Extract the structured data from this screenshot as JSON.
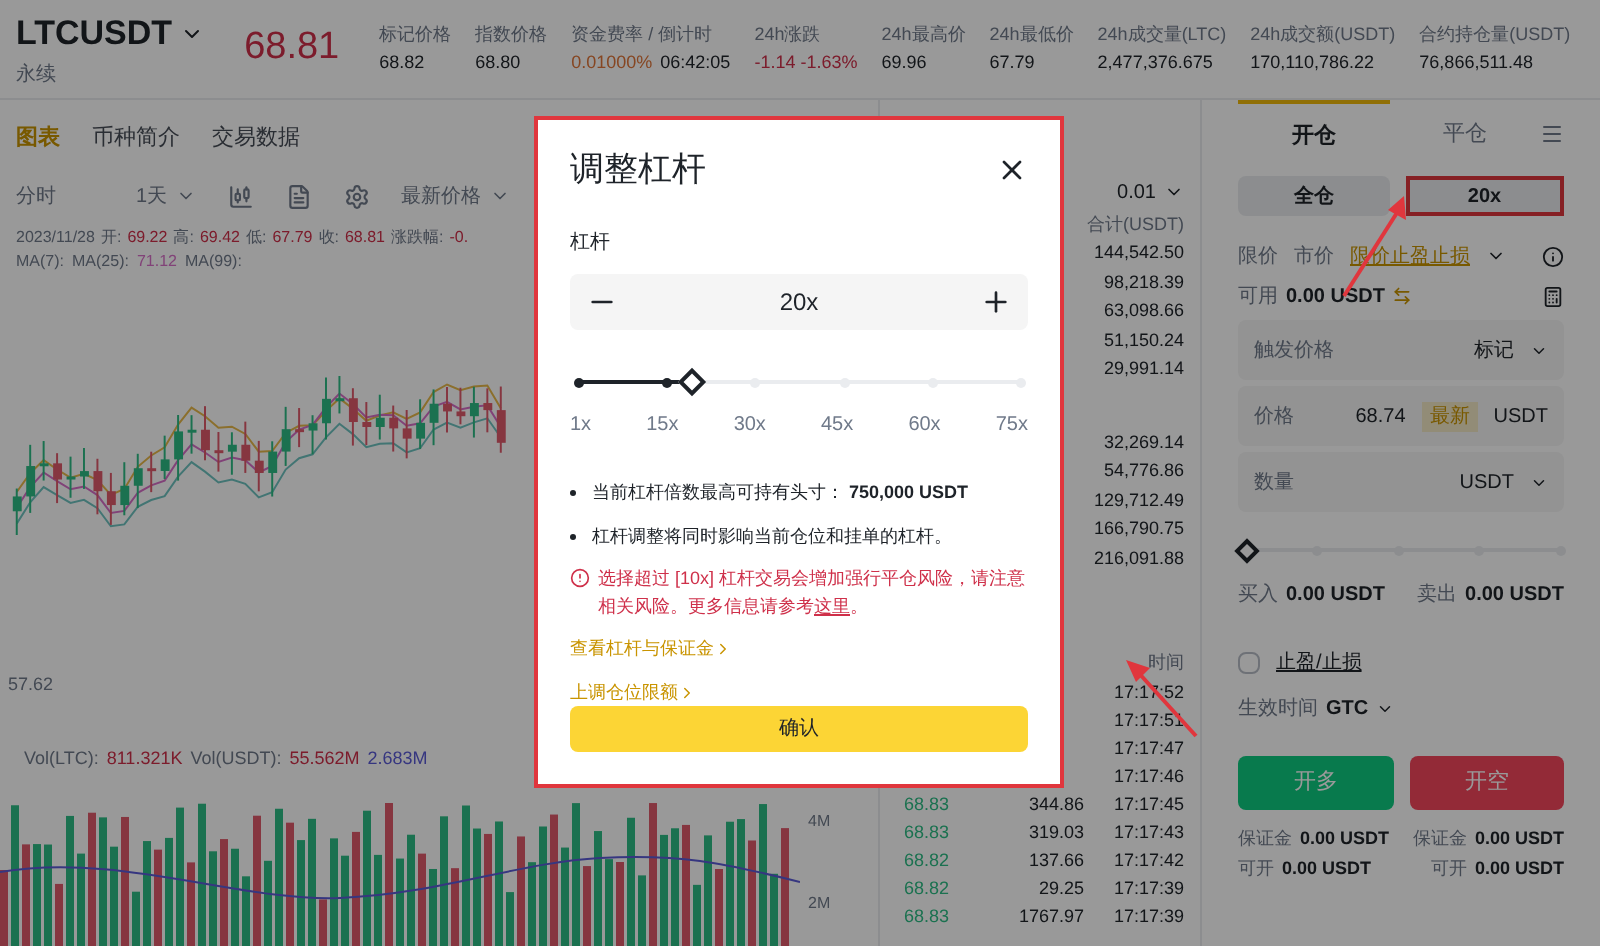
{
  "header": {
    "symbol": "LTCUSDT",
    "subtitle": "永续",
    "price": "68.81",
    "stats": [
      {
        "label": "标记价格",
        "values": [
          {
            "text": "68.82",
            "kind": "plain"
          }
        ]
      },
      {
        "label": "指数价格",
        "values": [
          {
            "text": "68.80",
            "kind": "plain"
          }
        ]
      },
      {
        "label": "资金费率 / 倒计时",
        "values": [
          {
            "text": "0.01000%",
            "kind": "accent"
          },
          {
            "text": "06:42:05",
            "kind": "plain"
          }
        ]
      },
      {
        "label": "24h涨跌",
        "values": [
          {
            "text": "-1.14 -1.63%",
            "kind": "down"
          }
        ]
      },
      {
        "label": "24h最高价",
        "values": [
          {
            "text": "69.96",
            "kind": "plain"
          }
        ]
      },
      {
        "label": "24h最低价",
        "values": [
          {
            "text": "67.79",
            "kind": "plain"
          }
        ]
      },
      {
        "label": "24h成交量(LTC)",
        "values": [
          {
            "text": "2,477,376.675",
            "kind": "plain"
          }
        ]
      },
      {
        "label": "24h成交额(USDT)",
        "values": [
          {
            "text": "170,110,786.22",
            "kind": "plain"
          }
        ]
      },
      {
        "label": "合约持仓量(USDT)",
        "values": [
          {
            "text": "76,866,511.48",
            "kind": "plain"
          }
        ]
      }
    ]
  },
  "chart": {
    "tabs": [
      {
        "label": "图表",
        "selected": true
      },
      {
        "label": "币种简介",
        "selected": false
      },
      {
        "label": "交易数据",
        "selected": false
      }
    ],
    "interval": "分时",
    "period": "1天",
    "price_type": "最新价格",
    "ohlc": {
      "date": "2023/11/28",
      "items": [
        {
          "label": "开:",
          "value": "69.22"
        },
        {
          "label": "高:",
          "value": "69.42"
        },
        {
          "label": "低:",
          "value": "67.79"
        },
        {
          "label": "收:",
          "value": "68.81"
        },
        {
          "label": "涨跌幅:",
          "value": "-0."
        }
      ]
    },
    "ma": [
      {
        "label": "MA(7):"
      },
      {
        "label": "MA(25):",
        "value": "71.12"
      },
      {
        "label": "MA(99):"
      }
    ],
    "low_label": "57.62",
    "volume": {
      "items": [
        {
          "label": "Vol(LTC):",
          "value": "811.321K"
        },
        {
          "label": "Vol(USDT):",
          "value": "55.562M"
        },
        {
          "value": "2.683M"
        }
      ],
      "axis": [
        "4M",
        "2M"
      ]
    }
  },
  "order_book": {
    "tick": "0.01",
    "total_header": "合计(USDT)",
    "asks": [
      "144,542.50",
      "98,218.39",
      "63,098.66",
      "51,150.24",
      "29,991.14"
    ],
    "bids": [
      "32,269.14",
      "54,776.86",
      "129,712.49",
      "166,790.75",
      "216,091.88"
    ],
    "trades_header": "时间",
    "trades": [
      {
        "time": "17:17:52"
      },
      {
        "time": "17:17:51"
      },
      {
        "time": "17:17:47"
      },
      {
        "time": "17:17:46"
      },
      {
        "price": "68.83",
        "amount": "344.86",
        "time": "17:17:45"
      },
      {
        "price": "68.83",
        "amount": "319.03",
        "time": "17:17:43"
      },
      {
        "price": "68.82",
        "amount": "137.66",
        "time": "17:17:42"
      },
      {
        "price": "68.82",
        "amount": "29.25",
        "time": "17:17:39"
      },
      {
        "price": "68.83",
        "amount": "1767.97",
        "time": "17:17:39"
      }
    ]
  },
  "order_panel": {
    "tabs": [
      {
        "label": "开仓",
        "selected": true
      },
      {
        "label": "平仓",
        "selected": false
      }
    ],
    "margin_mode": "全仓",
    "leverage": "20x",
    "order_types": [
      {
        "label": "限价",
        "selected": false
      },
      {
        "label": "市价",
        "selected": false
      },
      {
        "label": "限价止盈止损",
        "selected": true
      }
    ],
    "available_label": "可用",
    "available": "0.00 USDT",
    "fields": [
      {
        "label": "触发价格",
        "unit": "标记",
        "kind": "select"
      },
      {
        "label": "价格",
        "value": "68.74",
        "badge": "最新",
        "unit": "USDT",
        "kind": "input"
      },
      {
        "label": "数量",
        "unit": "USDT",
        "kind": "select"
      }
    ],
    "level": 0,
    "buy_label": "买入",
    "buy": "0.00 USDT",
    "sell_label": "卖出",
    "sell": "0.00 USDT",
    "tpsl": {
      "label": "止盈/止损",
      "checked": false
    },
    "tif_label": "生效时间",
    "tif": "GTC",
    "long": "开多",
    "short": "开空",
    "summary": [
      {
        "label": "保证金",
        "value": "0.00 USDT"
      },
      {
        "label": "保证金",
        "value": "0.00 USDT"
      },
      {
        "label": "可开",
        "value": "0.00 USDT"
      },
      {
        "label": "可开",
        "value": "0.00 USDT"
      }
    ]
  },
  "modal": {
    "title": "调整杠杆",
    "label": "杠杆",
    "value": "20x",
    "level": 0.26,
    "marks": [
      "1x",
      "15x",
      "30x",
      "45x",
      "60x",
      "75x"
    ],
    "notes": [
      "当前杠杆倍数最高可持有头寸： **750,000 USDT**",
      "杠杆调整将同时影响当前仓位和挂单的杠杆。"
    ],
    "warning": "选择超过 [10x] 杠杆交易会增加强行平仓风险，请注意相关风险。更多信息请参考",
    "warning_link": "这里",
    "warning_end": "。",
    "links": [
      "查看杠杆与保证金",
      "上调仓位限额"
    ],
    "confirm": "确认"
  }
}
